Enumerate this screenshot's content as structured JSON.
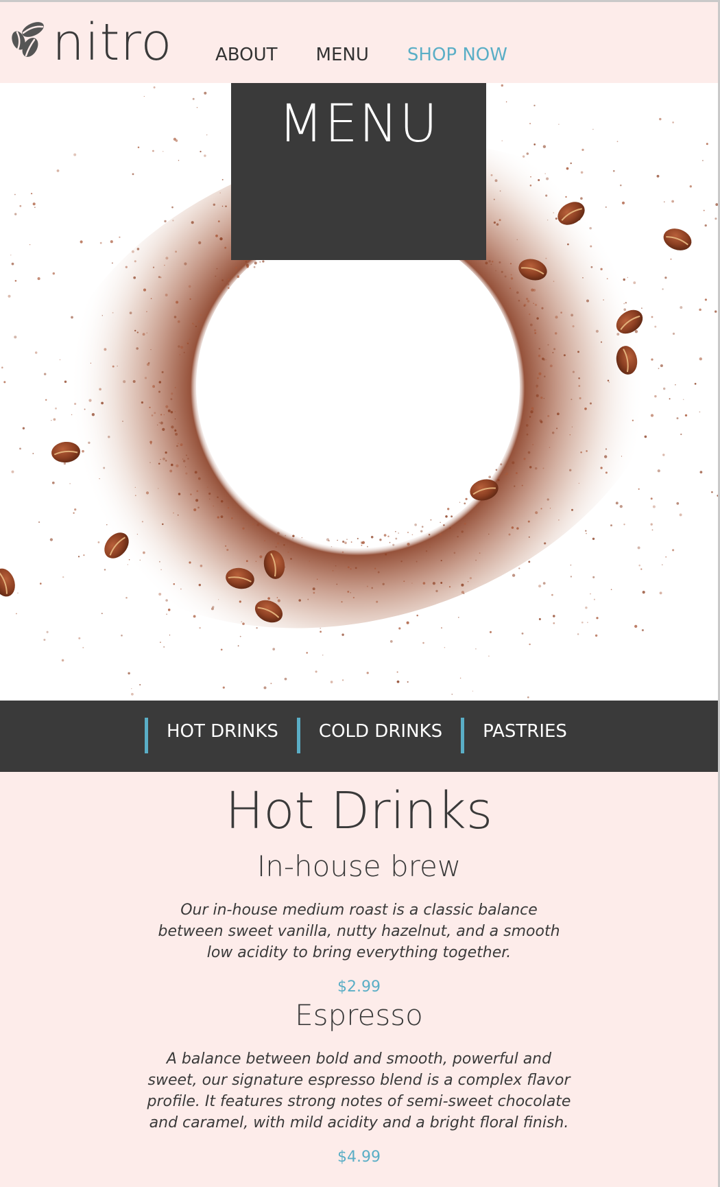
{
  "header": {
    "logo_text": "nitro",
    "logo_icon": "coffee-beans-icon",
    "nav": {
      "about": "ABOUT",
      "menu": "MENU",
      "shop": "SHOP NOW"
    }
  },
  "hero": {
    "banner_title": "MENU",
    "image": "coffee-grounds-ring-with-beans"
  },
  "categories": [
    "HOT DRINKS",
    "COLD DRINKS",
    "PASTRIES"
  ],
  "section": {
    "title": "Hot Drinks",
    "items": [
      {
        "name": "In-house brew",
        "description": "Our in-house medium roast is a classic balance between sweet vanilla, nutty hazelnut, and a smooth low acidity to bring everything together.",
        "price": "$2.99"
      },
      {
        "name": "Espresso",
        "description": "A balance between bold and smooth, powerful and sweet, our signature espresso blend is a complex flavor profile. It features strong notes of semi-sweet chocolate and caramel, with mild acidity and a bright floral finish.",
        "price": "$4.99"
      }
    ]
  },
  "colors": {
    "accent": "#5aaec6",
    "dark": "#3a3a3a",
    "background": "#fdecea",
    "coffee": "#7a3a22"
  }
}
